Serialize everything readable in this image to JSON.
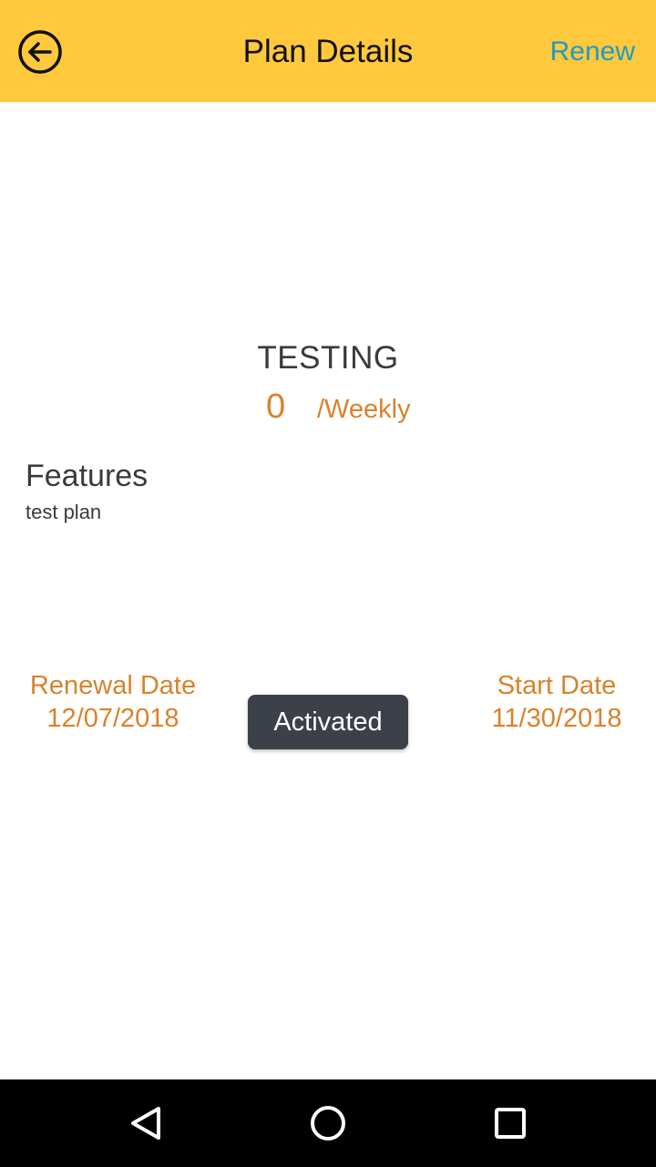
{
  "header": {
    "title": "Plan Details",
    "renew_label": "Renew",
    "back_icon": "arrow-left-circle-icon",
    "background_color": "#ffc83d",
    "renew_color": "#1e9bc7"
  },
  "plan": {
    "name": "TESTING",
    "price": "0",
    "period": "/Weekly",
    "accent_color": "#d9822b"
  },
  "features": {
    "heading": "Features",
    "text": "test plan"
  },
  "dates": {
    "renewal_label": "Renewal Date",
    "renewal_value": "12/07/2018",
    "start_label": "Start Date",
    "start_value": "11/30/2018"
  },
  "toast": {
    "text": "Activated"
  },
  "system_nav": {
    "back_icon": "triangle-back-icon",
    "home_icon": "circle-home-icon",
    "recents_icon": "square-recents-icon"
  }
}
